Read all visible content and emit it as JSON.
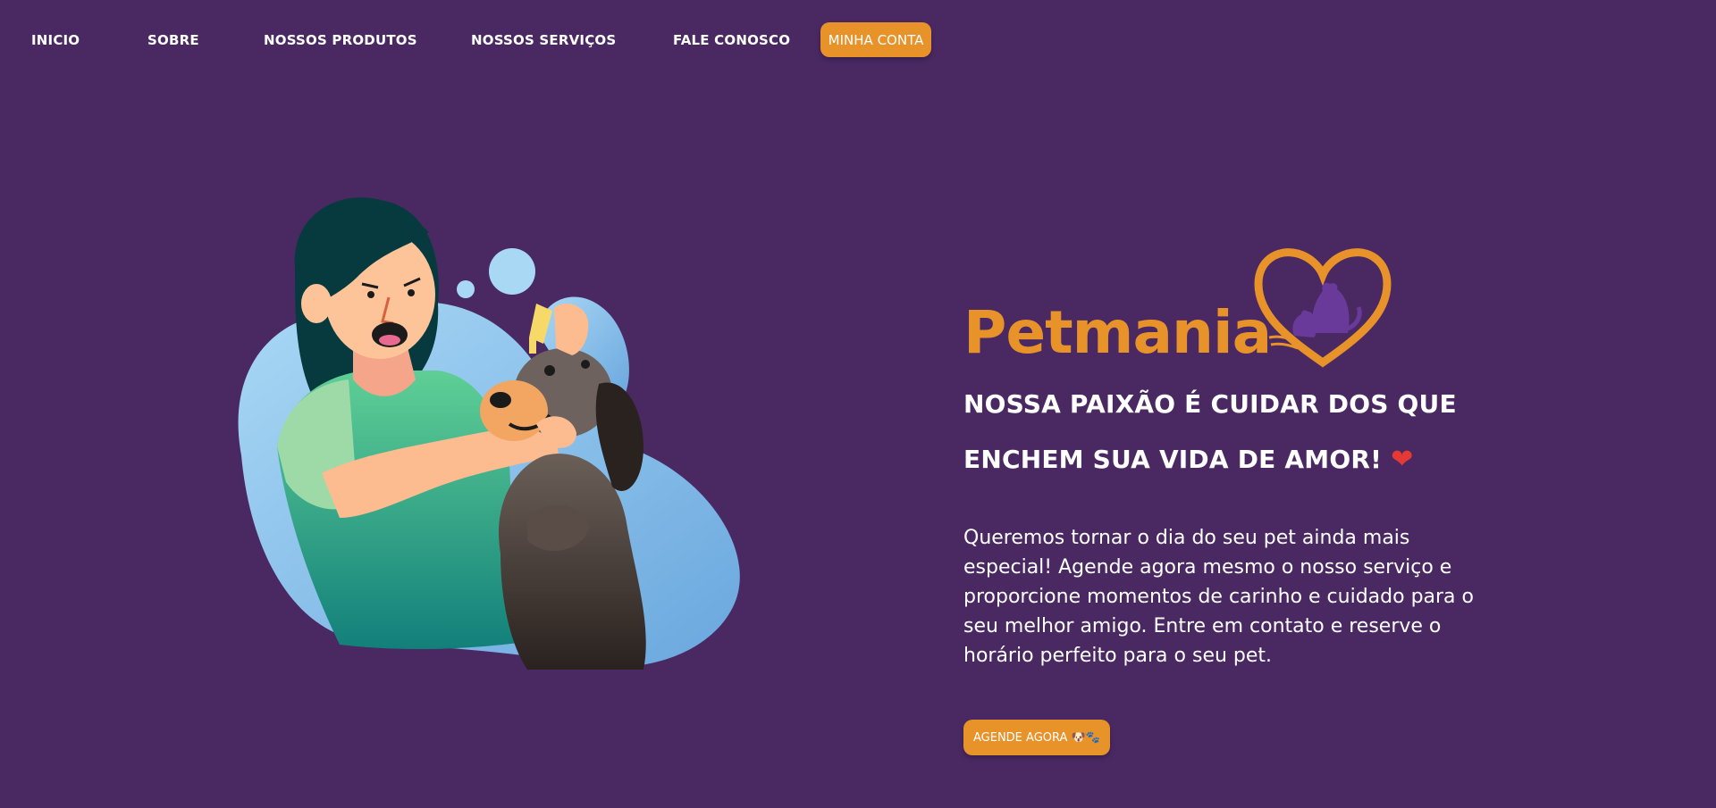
{
  "nav": {
    "items": [
      {
        "label": "INICIO"
      },
      {
        "label": "SOBRE"
      },
      {
        "label": "NOSSOS PRODUTOS"
      },
      {
        "label": "NOSSOS SERVIÇOS"
      },
      {
        "label": "FALE CONOSCO"
      }
    ],
    "account_label": "MINHA CONTA"
  },
  "hero": {
    "brand": "Petmania",
    "tagline_line1": "NOSSA PAIXÃO É CUIDAR DOS QUE",
    "tagline_line2": "ENCHEM SUA VIDA DE AMOR!",
    "heart": "❤",
    "description": "Queremos tornar o dia do seu pet ainda mais especial! Agende agora mesmo o nosso serviço e proporcione momentos de carinho e cuidado para o seu melhor amigo. Entre em contato e reserve o horário perfeito para o seu pet.",
    "cta_label": "AGENDE AGORA 🐶🐾"
  },
  "colors": {
    "background": "#4a2963",
    "accent": "#e8922a",
    "heart": "#e53935"
  },
  "icons": {
    "logo": "heart-pets-logo-icon",
    "illustration": "woman-grooming-dog-illustration"
  }
}
